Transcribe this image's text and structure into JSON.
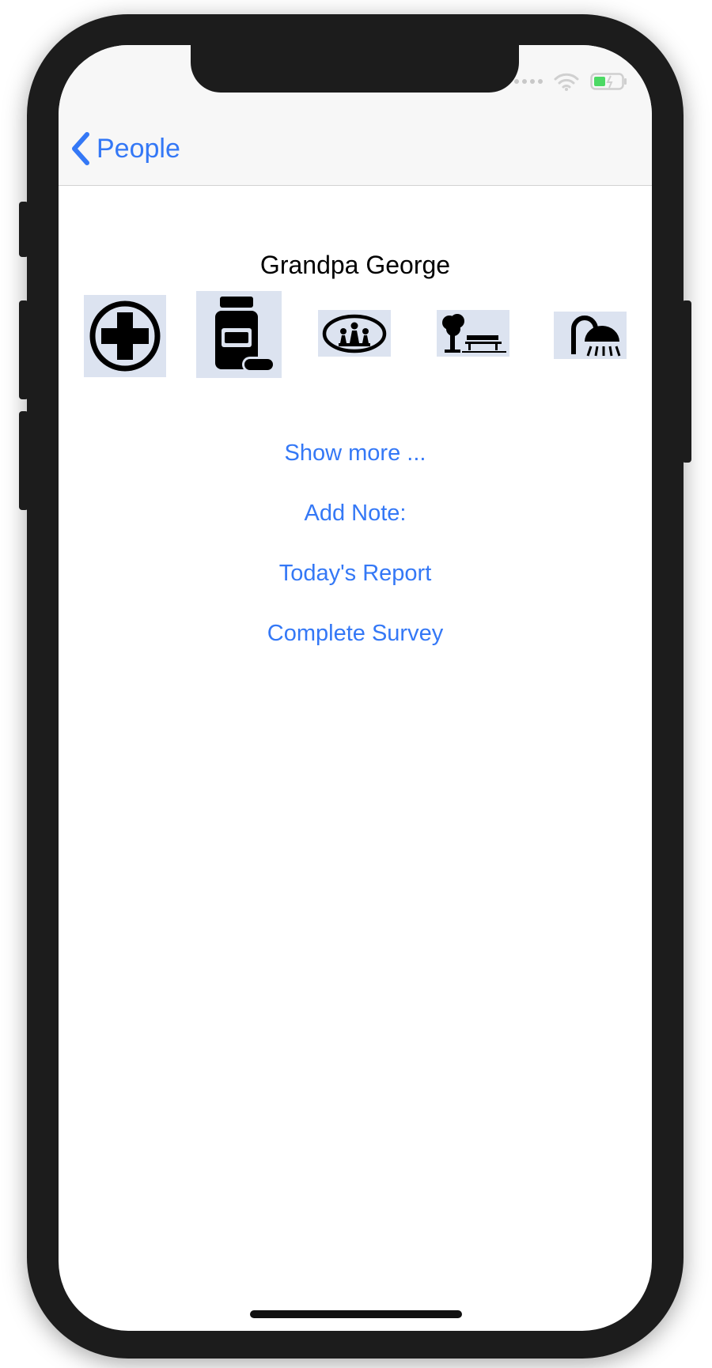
{
  "nav": {
    "back_label": "People"
  },
  "person": {
    "name": "Grandpa George"
  },
  "actions": [
    {
      "icon": "medical-cross-icon"
    },
    {
      "icon": "medication-bottle-icon"
    },
    {
      "icon": "chess-pieces-icon"
    },
    {
      "icon": "park-bench-tree-icon"
    },
    {
      "icon": "shower-icon"
    }
  ],
  "links": {
    "show_more": "Show more ...",
    "add_note": "Add Note:",
    "todays_report": "Today's Report",
    "complete_survey": "Complete Survey"
  },
  "colors": {
    "accent": "#3478f6",
    "tile_bg": "#dce3f0",
    "battery_fill": "#4cd964"
  }
}
